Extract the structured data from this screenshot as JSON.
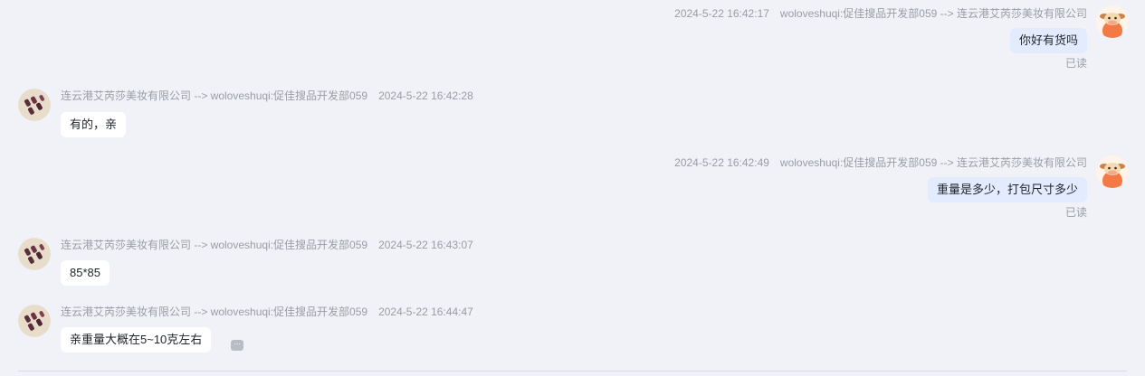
{
  "messages": [
    {
      "side": "right",
      "time": "2024-5-22 16:42:17",
      "route": "woloveshuqi:促佳搜品开发部059 --> 连云港艾芮莎美妆有限公司",
      "text": "你好有货吗",
      "status": "已读"
    },
    {
      "side": "left",
      "time": "2024-5-22 16:42:28",
      "route": "连云港艾芮莎美妆有限公司 --> woloveshuqi:促佳搜品开发部059",
      "text": "有的，亲"
    },
    {
      "side": "right",
      "time": "2024-5-22 16:42:49",
      "route": "woloveshuqi:促佳搜品开发部059 --> 连云港艾芮莎美妆有限公司",
      "text": "重量是多少，打包尺寸多少",
      "status": "已读"
    },
    {
      "side": "left",
      "time": "2024-5-22 16:43:07",
      "route": "连云港艾芮莎美妆有限公司 --> woloveshuqi:促佳搜品开发部059",
      "text": "85*85"
    },
    {
      "side": "left",
      "time": "2024-5-22 16:44:47",
      "route": "连云港艾芮莎美妆有限公司 --> woloveshuqi:促佳搜品开发部059",
      "text": "亲重量大概在5~10克左右"
    }
  ],
  "icons": {
    "more": "more-dots-icon",
    "agent_avatar": "cow-avatar-icon",
    "shop_avatar": "nail-product-avatar-icon"
  },
  "colors": {
    "background": "#f0f2f7",
    "outgoing_bubble": "#e3ecff",
    "incoming_bubble": "#ffffff",
    "meta_text": "#9a9da3"
  }
}
